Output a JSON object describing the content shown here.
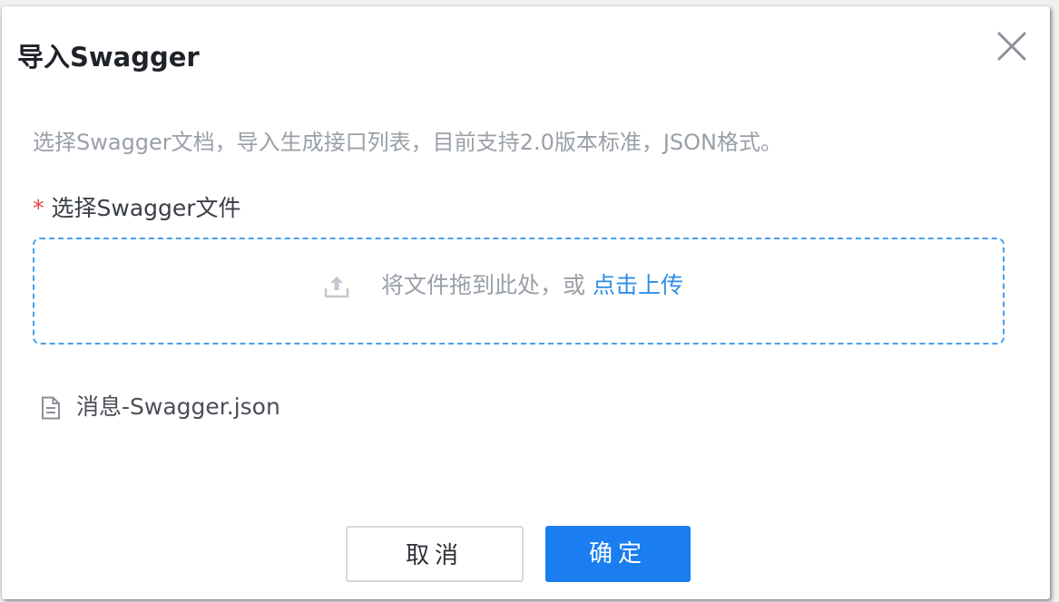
{
  "dialog": {
    "title": "导入Swagger",
    "description": "选择Swagger文档，导入生成接口列表，目前支持2.0版本标准，JSON格式。",
    "field": {
      "required_mark": "*",
      "label": "选择Swagger文件"
    },
    "dropzone": {
      "text": "将文件拖到此处，或 ",
      "link": "点击上传"
    },
    "files": [
      {
        "name": "消息-Swagger.json"
      }
    ],
    "buttons": {
      "cancel": "取消",
      "confirm": "确定"
    },
    "icons": {
      "close": "close-icon",
      "upload": "upload-icon",
      "file": "document-icon"
    },
    "colors": {
      "primary": "#1a7ef0",
      "link": "#2f8ee6",
      "required": "#e0443e",
      "dropzone_border": "#4aa0ec",
      "muted_text": "#9aa0a8"
    }
  }
}
